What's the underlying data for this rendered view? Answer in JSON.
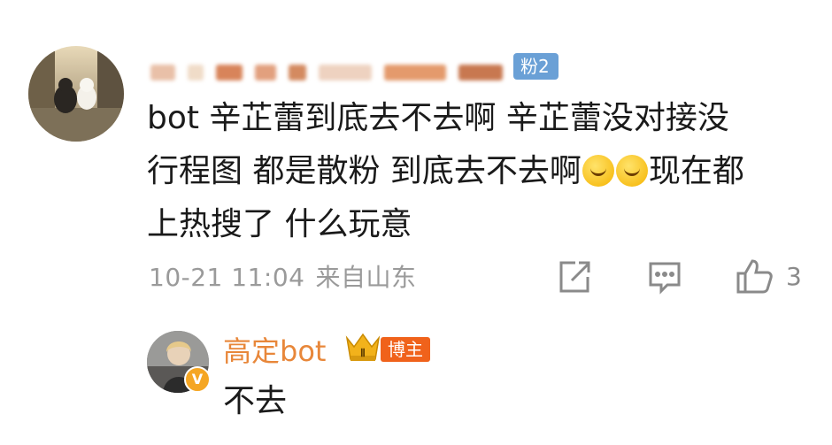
{
  "comment": {
    "author_badge": "粉2",
    "text_line1": "bot 辛芷蕾到底去不去啊 辛芷蕾没对接没",
    "text_line2_a": "行程图 都是散粉 到底去不去啊",
    "text_line2_b": "现在都",
    "text_line3": "上热搜了 什么玩意",
    "timestamp": "10-21 11:04",
    "source": "来自山东",
    "like_count": "3"
  },
  "reply": {
    "author": "高定bot",
    "tag": "博主",
    "text": "不去",
    "verify_label": "V"
  },
  "icons": [
    "share-icon",
    "reply-icon",
    "like-icon",
    "crown-icon",
    "verified-icon",
    "emoji-icon"
  ],
  "colors": {
    "reply_name": "#e8873a",
    "blogger_tag": "#f0621b",
    "fan_badge": "#6aa0d6",
    "meta_gray": "#9a9a9a"
  }
}
